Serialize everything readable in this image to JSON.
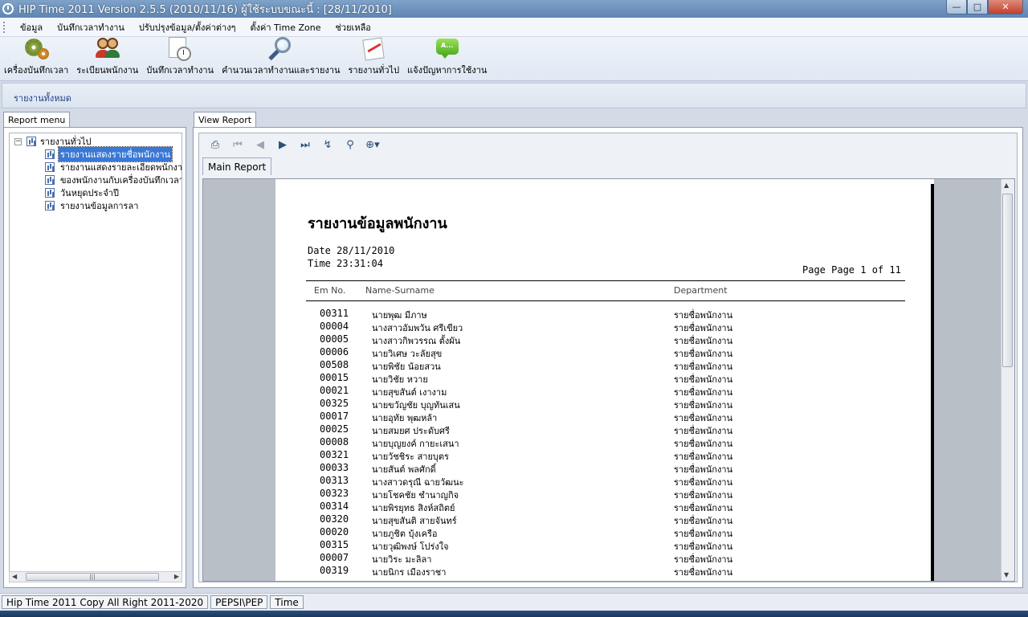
{
  "window": {
    "title": "HIP Time 2011 Version 2.5.5 (2010/11/16)   ผู้ใช้ระบบขณะนี้  :  [28/11/2010]"
  },
  "menu": {
    "items": [
      "ข้อมูล",
      "บันทึกเวลาทำงาน",
      "ปรับปรุงข้อมูล/ตั้งค่าต่างๆ",
      "ตั้งค่า Time Zone",
      "ช่วยเหลือ"
    ]
  },
  "toolbar": {
    "items": [
      {
        "label": "เครื่องบันทึกเวลา",
        "icon": "gears-icon"
      },
      {
        "label": "ระเบียนพนักงาน",
        "icon": "employees-icon"
      },
      {
        "label": "บันทึกเวลาทำงาน",
        "icon": "calendar-clock-icon"
      },
      {
        "label": "คำนวนเวลาทำงานและรายงาน",
        "icon": "magnifier-icon"
      },
      {
        "label": "รายงานทั่วไป",
        "icon": "report-chart-icon"
      },
      {
        "label": "แจ้งปัญหาการใช้งาน",
        "icon": "chat-bubble-icon"
      }
    ]
  },
  "breadcrumb": "รายงานทั้งหมด",
  "left_panel": {
    "tab": "Report menu",
    "root": "รายงานทั่วไป",
    "items": [
      "รายงานแสดงรายชื่อพนักงาน",
      "รายงานแสดงรายละเอียดพนักงาน",
      "ของพนักงานกับเครื่องบันทึกเวลา",
      "วันหยุดประจำปี",
      "รายงานข้อมูลการลา"
    ]
  },
  "right_panel": {
    "tab": "View Report",
    "subtab": "Main Report",
    "tools": [
      "print-icon",
      "first-page-icon",
      "prev-page-icon",
      "next-page-icon",
      "last-page-icon",
      "export-icon",
      "find-icon",
      "zoom-icon"
    ]
  },
  "report": {
    "title": "รายงานข้อมูลพนักงาน",
    "date_line": "Date 28/11/2010",
    "time_line": "Time 23:31:04",
    "page_line": "Page Page 1 of 11",
    "col_empno": "Em No.",
    "col_name": "Name-Surname",
    "col_dept": "Department",
    "rows": [
      {
        "no": "00311",
        "name": "นายพุฒ    มีภาษ",
        "dept": "รายชื่อพนักงาน"
      },
      {
        "no": "00004",
        "name": "นางสาวอัมพวัน    ศรีเขียว",
        "dept": "รายชื่อพนักงาน"
      },
      {
        "no": "00005",
        "name": "นางสาวกิพวรรณ    ตั้งผัน",
        "dept": "รายชื่อพนักงาน"
      },
      {
        "no": "00006",
        "name": "นายวิเศษ    วะลัยสุข",
        "dept": "รายชื่อพนักงาน"
      },
      {
        "no": "00508",
        "name": "นายพิชัย    น้อยสวน",
        "dept": "รายชื่อพนักงาน"
      },
      {
        "no": "00015",
        "name": "นายวิชัย    หวาย",
        "dept": "รายชื่อพนักงาน"
      },
      {
        "no": "00021",
        "name": "นายสุขสันต์    เงางาม",
        "dept": "รายชื่อพนักงาน"
      },
      {
        "no": "00325",
        "name": "นายขวัญชัย    บุญทันเสน",
        "dept": "รายชื่อพนักงาน"
      },
      {
        "no": "00017",
        "name": "นายอุทัย    พุฒหล้า",
        "dept": "รายชื่อพนักงาน"
      },
      {
        "no": "00025",
        "name": "นายสมยศ    ประดับศรี",
        "dept": "รายชื่อพนักงาน"
      },
      {
        "no": "00008",
        "name": "นายบุญยงค์    กายะเสนา",
        "dept": "รายชื่อพนักงาน"
      },
      {
        "no": "00321",
        "name": "นายวัชชิระ    สายบุตร",
        "dept": "รายชื่อพนักงาน"
      },
      {
        "no": "00033",
        "name": "นายสันต์    พลศักดิ์",
        "dept": "รายชื่อพนักงาน"
      },
      {
        "no": "00313",
        "name": "นางสาวดรุณี    ฉายวัฒนะ",
        "dept": "รายชื่อพนักงาน"
      },
      {
        "no": "00323",
        "name": "นายโชคชัย    ชำนาญกิจ",
        "dept": "รายชื่อพนักงาน"
      },
      {
        "no": "00314",
        "name": "นายพิรยุทธ    สิงห์สถิตย์",
        "dept": "รายชื่อพนักงาน"
      },
      {
        "no": "00320",
        "name": "นายสุขสันติ    สายจันทร์",
        "dept": "รายชื่อพนักงาน"
      },
      {
        "no": "00020",
        "name": "นายภูชิต    บุ้งเครือ",
        "dept": "รายชื่อพนักงาน"
      },
      {
        "no": "00315",
        "name": "นายวุฒิพงษ์    โปร่งใจ",
        "dept": "รายชื่อพนักงาน"
      },
      {
        "no": "00007",
        "name": "นายวิระ    มะลิลา",
        "dept": "รายชื่อพนักงาน"
      },
      {
        "no": "00319",
        "name": "นายนิกร    เมืองราชา",
        "dept": "รายชื่อพนักงาน"
      }
    ]
  },
  "status": {
    "copyright": "Hip Time 2011 Copy All Right 2011-2020",
    "db": "PEPSI\\PEP",
    "time": "Time"
  }
}
